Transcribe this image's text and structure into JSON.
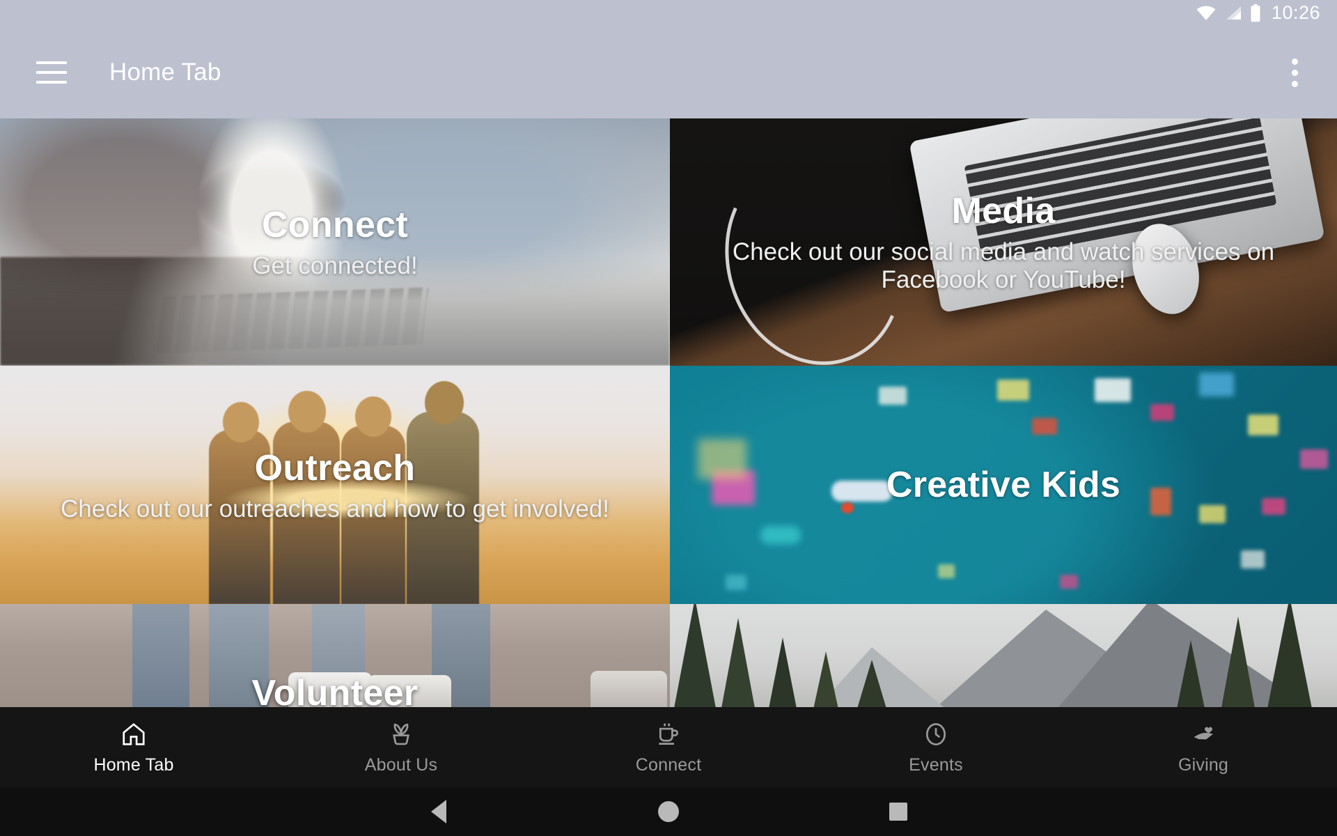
{
  "status_bar": {
    "time": "10:26",
    "icons": [
      "wifi-icon",
      "cellular-signal-icon",
      "battery-icon"
    ]
  },
  "app_bar": {
    "menu_icon": "hamburger-menu-icon",
    "title": "Home Tab",
    "overflow_icon": "overflow-menu-icon"
  },
  "tiles": [
    {
      "id": "connect",
      "title": "Connect",
      "subtitle": "Get connected!"
    },
    {
      "id": "media",
      "title": "Media",
      "subtitle": "Check out our social media and watch services on Facebook or YouTube!"
    },
    {
      "id": "outreach",
      "title": "Outreach",
      "subtitle": "Check out our outreaches and how to get involved!"
    },
    {
      "id": "creative-kids",
      "title": "Creative Kids",
      "subtitle": ""
    },
    {
      "id": "volunteer",
      "title": "Volunteer",
      "subtitle": ""
    },
    {
      "id": "mountains",
      "title": "",
      "subtitle": ""
    }
  ],
  "bottom_nav": {
    "items": [
      {
        "label": "Home Tab",
        "icon": "home-icon",
        "active": true
      },
      {
        "label": "About Us",
        "icon": "sprout-icon",
        "active": false
      },
      {
        "label": "Connect",
        "icon": "coffee-cup-icon",
        "active": false
      },
      {
        "label": "Events",
        "icon": "clock-icon",
        "active": false
      },
      {
        "label": "Giving",
        "icon": "giving-hand-icon",
        "active": false
      }
    ]
  },
  "system_nav": {
    "back": "back-triangle-icon",
    "home": "home-circle-icon",
    "recents": "recents-square-icon"
  },
  "colors": {
    "app_bar": "#bdc0ce",
    "bottom_nav": "#151515",
    "system_nav": "#0f0f10",
    "creative_kids_teal": "#0d7288",
    "active_label": "#ffffff",
    "inactive_label": "#9a9a9a"
  }
}
